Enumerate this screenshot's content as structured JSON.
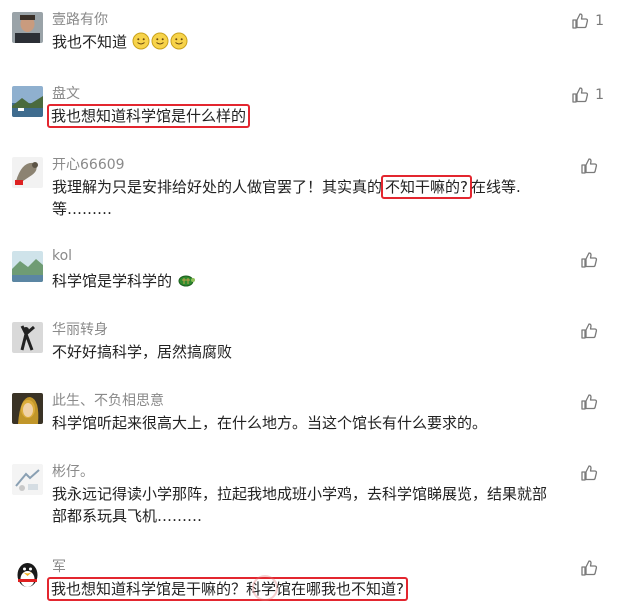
{
  "comments": [
    {
      "name": "壹路有你",
      "likes": "1",
      "text": "我也不知道",
      "emojis": 3
    },
    {
      "name": "盘文",
      "likes": "1",
      "text_highlight": "我也想知道科学馆是什么样的"
    },
    {
      "name": "开心66609",
      "likes": "",
      "text_a": "我理解为只是安排给好处的人做官罢了！其实真的",
      "text_highlight": "不知干嘛的?",
      "text_b": "在线等.",
      "text_line2": "等………"
    },
    {
      "name": "kol",
      "likes": "",
      "text": "科学馆是学科学的"
    },
    {
      "name": "华丽转身",
      "likes": "",
      "text": "不好好搞科学，居然搞腐败"
    },
    {
      "name": "此生、不负相思意",
      "likes": "",
      "text": "科学馆听起来很高大上，在什么地方。当这个馆长有什么要求的。"
    },
    {
      "name": "彬仔。",
      "likes": "",
      "text": "我永远记得读小学那阵，拉起我地成班小学鸡，去科学馆睇展览，结果就部",
      "text_line2": "部都系玩具飞机………"
    },
    {
      "name": "军",
      "likes": "",
      "text_highlight": "我也想知道科学馆是干嘛的？科学馆在哪我也不知道?"
    }
  ],
  "colors": {
    "highlight": "#e3262f",
    "name": "#8a8a8a",
    "text": "#222222",
    "like": "#7a7a7a"
  },
  "icons": {
    "like": "thumbs-up-icon",
    "emoji": "smile-emoji-icon",
    "turtle": "turtle-emoji-icon"
  }
}
